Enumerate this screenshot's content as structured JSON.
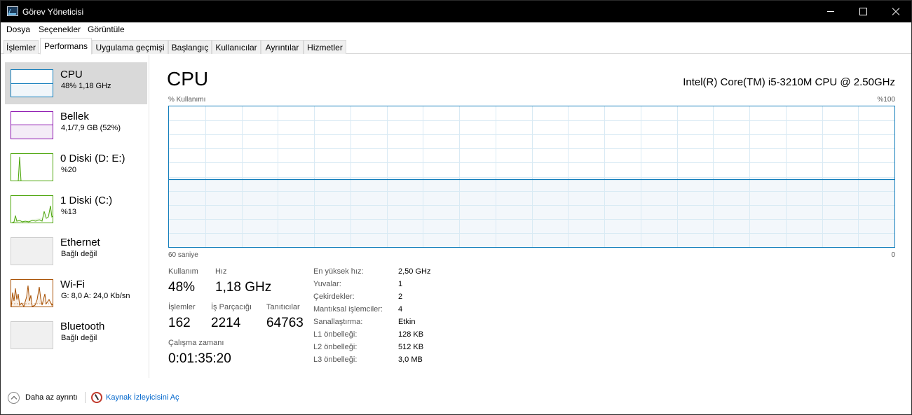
{
  "window": {
    "title": "Görev Yöneticisi"
  },
  "menu": [
    "Dosya",
    "Seçenekler",
    "Görüntüle"
  ],
  "tabs": [
    "İşlemler",
    "Performans",
    "Uygulama geçmişi",
    "Başlangıç",
    "Kullanıcılar",
    "Ayrıntılar",
    "Hizmetler"
  ],
  "active_tab": "Performans",
  "sidebar": {
    "items": [
      {
        "name": "CPU",
        "detail": "48% 1,18 GHz",
        "icon": "cpu-graph-icon",
        "color": "#117dbb"
      },
      {
        "name": "Bellek",
        "detail": "4,1/7,9 GB (52%)",
        "icon": "memory-graph-icon",
        "color": "#8b12ae"
      },
      {
        "name": "0 Diski (D: E:)",
        "detail": "%20",
        "icon": "disk-graph-icon",
        "color": "#4da60c"
      },
      {
        "name": "1 Diski (C:)",
        "detail": "%13",
        "icon": "disk-graph-icon",
        "color": "#4da60c"
      },
      {
        "name": "Ethernet",
        "detail": "Bağlı değil",
        "icon": "ethernet-graph-icon",
        "color": "#cccccc"
      },
      {
        "name": "Wi-Fi",
        "detail": "G: 8,0  A: 24,0 Kb/sn",
        "icon": "wifi-graph-icon",
        "color": "#a74f01"
      },
      {
        "name": "Bluetooth",
        "detail": "Bağlı değil",
        "icon": "bluetooth-graph-icon",
        "color": "#cccccc"
      }
    ]
  },
  "main": {
    "title": "CPU",
    "cpu_model": "Intel(R) Core(TM) i5-3210M CPU @ 2.50GHz",
    "graph": {
      "y_label": "% Kullanımı",
      "y_max_label": "%100",
      "x_label_left": "60 saniye",
      "x_label_right": "0",
      "usage_percent": 48,
      "line_color": "#117dbb",
      "fill_color": "#f1f6fa",
      "grid_color": "#d9eaf4"
    },
    "stats": {
      "usage_label": "Kullanım",
      "usage_value": "48%",
      "speed_label": "Hız",
      "speed_value": "1,18 GHz",
      "processes_label": "İşlemler",
      "processes_value": "162",
      "threads_label": "İş Parçacığı",
      "threads_value": "2214",
      "handles_label": "Tanıtıcılar",
      "handles_value": "64763",
      "uptime_label": "Çalışma zamanı",
      "uptime_value": "0:01:35:20"
    },
    "info": [
      {
        "label": "En yüksek hız:",
        "value": "2,50 GHz"
      },
      {
        "label": "Yuvalar:",
        "value": "1"
      },
      {
        "label": "Çekirdekler:",
        "value": "2"
      },
      {
        "label": "Mantıksal işlemciler:",
        "value": "4"
      },
      {
        "label": "Sanallaştırma:",
        "value": "Etkin"
      },
      {
        "label": "L1 önbelleği:",
        "value": "128 KB"
      },
      {
        "label": "L2 önbelleği:",
        "value": "512 KB"
      },
      {
        "label": "L3 önbelleği:",
        "value": "3,0 MB"
      }
    ]
  },
  "footer": {
    "fewer_details": "Daha az ayrıntı",
    "open_resmon": "Kaynak İzleyicisini Aç"
  }
}
